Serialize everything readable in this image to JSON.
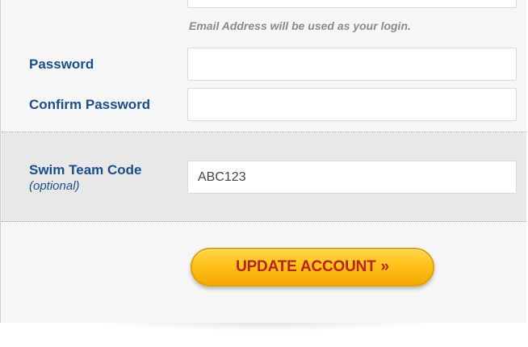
{
  "form": {
    "email_hint": "Email Address will be used as your login.",
    "password": {
      "label": "Password",
      "value": "",
      "placeholder": ""
    },
    "confirm_password": {
      "label": "Confirm Password",
      "value": "",
      "placeholder": ""
    },
    "swim_team_code": {
      "label": "Swim Team Code",
      "sublabel": "(optional)",
      "value": "ABC123",
      "placeholder": ""
    },
    "submit": {
      "label": "UPDATE ACCOUNT",
      "arrows": "»"
    }
  },
  "colors": {
    "label_blue": "#1b4f8a",
    "button_text_red": "#b8231a",
    "button_yellow": "#ffc21a",
    "hint_gray": "#8a8a8a"
  }
}
